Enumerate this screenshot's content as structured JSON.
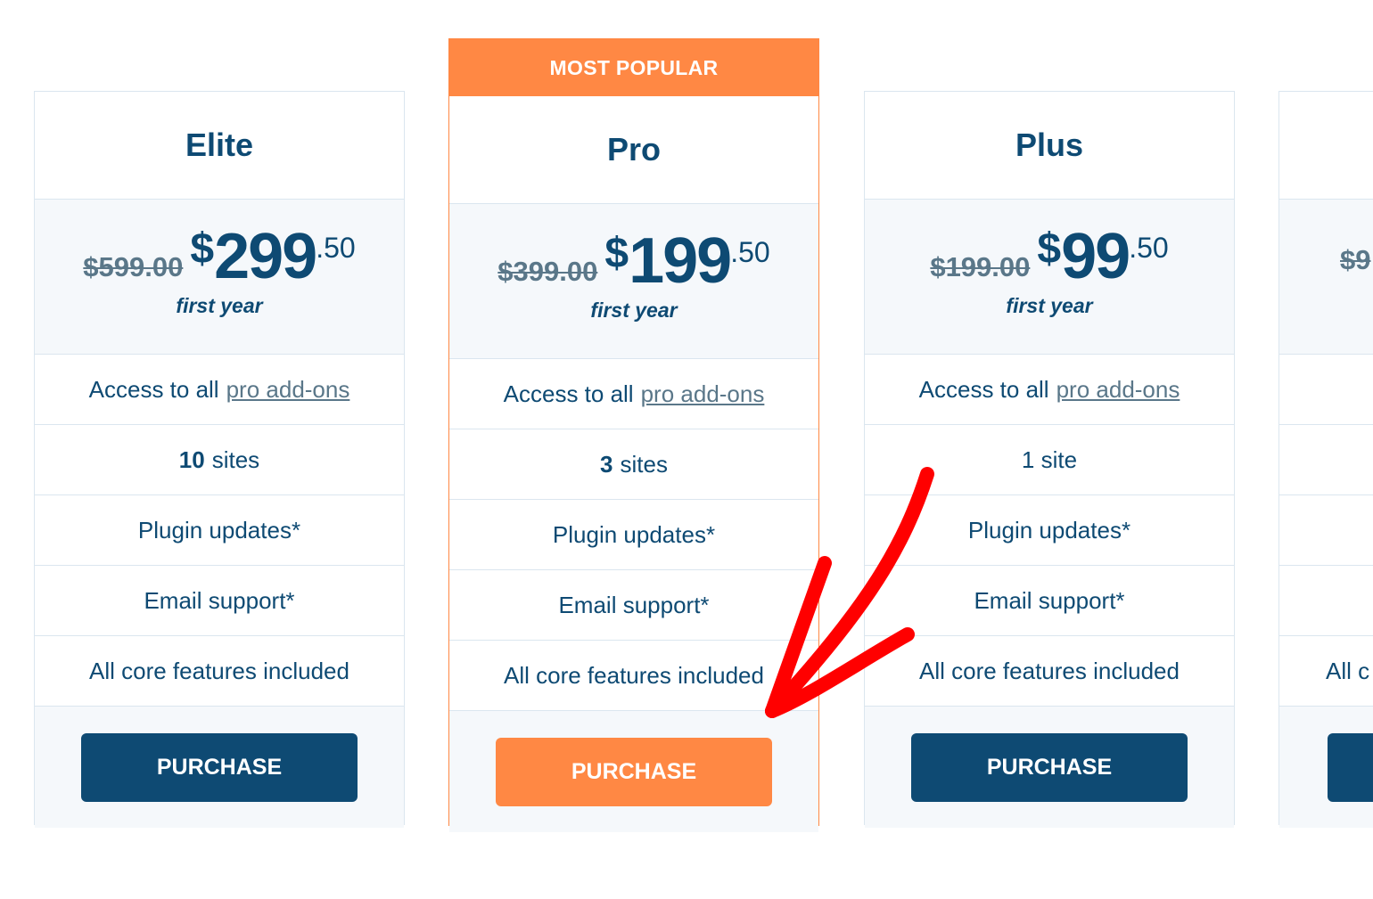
{
  "plans": [
    {
      "name": "Elite",
      "old_price": "$599.00",
      "currency": "$",
      "price_whole": "299",
      "price_cents": ".50",
      "period": "first year",
      "features": {
        "addons_prefix": "Access to all",
        "addons_link": "pro add-ons",
        "sites_count": "10",
        "sites_label": "sites",
        "updates": "Plugin updates*",
        "support": "Email support*",
        "core": "All core features included"
      },
      "button": "PURCHASE"
    },
    {
      "name": "Pro",
      "badge": "MOST POPULAR",
      "old_price": "$399.00",
      "currency": "$",
      "price_whole": "199",
      "price_cents": ".50",
      "period": "first year",
      "features": {
        "addons_prefix": "Access to all",
        "addons_link": "pro add-ons",
        "sites_count": "3",
        "sites_label": "sites",
        "updates": "Plugin updates*",
        "support": "Email support*",
        "core": "All core features included"
      },
      "button": "PURCHASE"
    },
    {
      "name": "Plus",
      "old_price": "$199.00",
      "currency": "$",
      "price_whole": "99",
      "price_cents": ".50",
      "period": "first year",
      "features": {
        "addons_prefix": "Access to all",
        "addons_link": "pro add-ons",
        "sites_count": "",
        "sites_label": "1 site",
        "updates": "Plugin updates*",
        "support": "Email support*",
        "core": "All core features included"
      },
      "button": "PURCHASE"
    },
    {
      "old_price_partial": "$9",
      "core_partial": "All c"
    }
  ],
  "colors": {
    "primary": "#0e4a73",
    "accent": "#ff8844",
    "annotation": "#ff0000"
  }
}
